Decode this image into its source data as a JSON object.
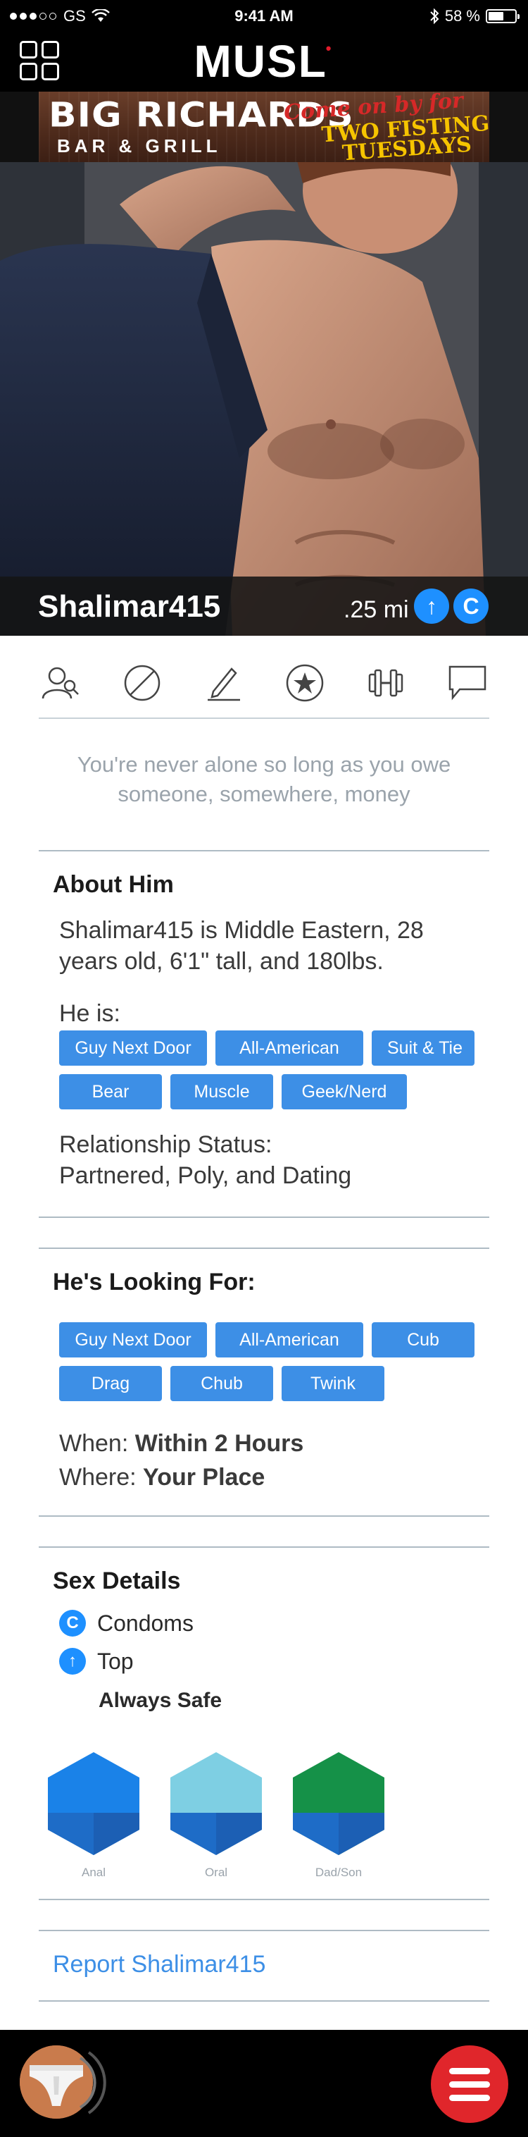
{
  "status_bar": {
    "carrier": "GS",
    "time": "9:41 AM",
    "battery": "58 %",
    "battery_level": 0.58
  },
  "header": {
    "logo": "MUSL",
    "logo_accent": "•"
  },
  "ad": {
    "brand": "BIG RICHARDS",
    "subtitle": "BAR & GRILL",
    "promo_script": "Come on by for",
    "promo_main": "TWO FISTING TUESDAYS"
  },
  "profile": {
    "username": "Shalimar415",
    "distance": ".25 mi",
    "badge_top": "↑",
    "badge_condom": "C"
  },
  "actions": [
    "profile-icon",
    "block-icon",
    "edit-icon",
    "favorite-icon",
    "gym-icon",
    "chat-icon"
  ],
  "quote": "You're never alone so long as you owe someone, somewhere, money",
  "about": {
    "title": "About Him",
    "summary": "Shalimar415 is Middle Eastern, 28 years old, 6'1\" tall, and 180lbs.",
    "he_is_label": "He is:",
    "tags": [
      "Guy Next Door",
      "All-American",
      "Suit & Tie",
      "Bear",
      "Muscle",
      "Geek/Nerd"
    ],
    "relationship_label": "Relationship Status:",
    "relationship_value": "Partnered, Poly, and Dating"
  },
  "looking_for": {
    "title": "He's Looking For:",
    "tags": [
      "Guy Next Door",
      "All-American",
      "Cub",
      "Drag",
      "Chub",
      "Twink"
    ],
    "when_label": "When:",
    "when_value": "Within 2 Hours",
    "where_label": "Where:",
    "where_value": "Your Place"
  },
  "sex_details": {
    "title": "Sex Details",
    "condom_badge": "C",
    "condom_label": "Condoms",
    "position_badge": "↑",
    "position_label": "Top",
    "safety": "Always Safe",
    "hexes": [
      {
        "label": "Anal",
        "color": "#1a82e8"
      },
      {
        "label": "Oral",
        "color": "#7ecfe3"
      },
      {
        "label": "Dad/Son",
        "color": "#159148"
      }
    ]
  },
  "report": {
    "label": "Report Shalimar415"
  },
  "colors": {
    "accent_blue": "#3d8fe6",
    "badge_blue": "#1e90ff",
    "brand_red": "#e21b2b",
    "menu_red": "#e0262b"
  }
}
